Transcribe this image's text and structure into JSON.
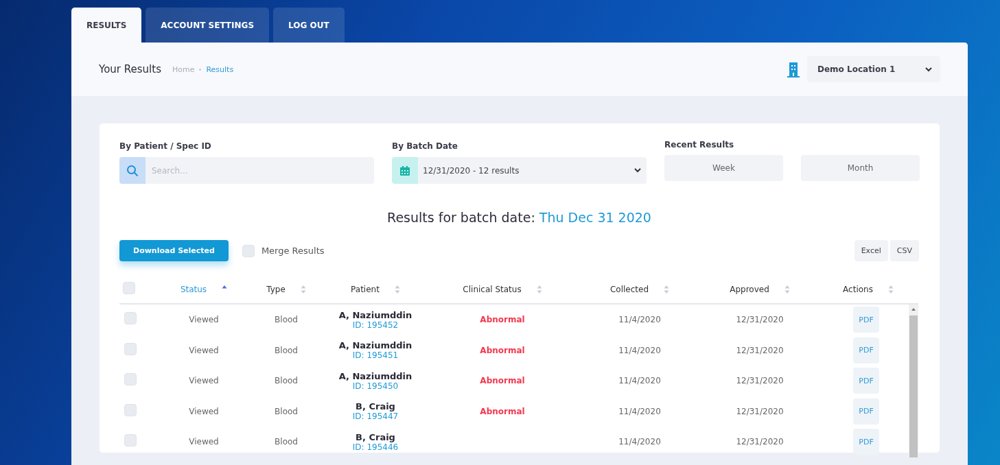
{
  "tabs": [
    {
      "label": "RESULTS",
      "selected": true
    },
    {
      "label": "ACCOUNT SETTINGS",
      "selected": false
    },
    {
      "label": "LOG OUT",
      "selected": false
    }
  ],
  "header": {
    "title": "Your Results",
    "breadcrumb": [
      {
        "label": "Home",
        "current": false
      },
      {
        "label": "Results",
        "current": true
      }
    ],
    "location": "Demo Location 1"
  },
  "filters": {
    "patient_label": "By Patient / Spec ID",
    "search": {
      "placeholder": "Search..."
    },
    "batch_label": "By Batch Date",
    "batch_value": "12/31/2020 - 12 results",
    "recent_label": "Recent Results",
    "recent_buttons": [
      "Week",
      "Month"
    ]
  },
  "results_heading": {
    "prefix": "Results for batch date:",
    "date": "Thu Dec 31 2020"
  },
  "toolbar": {
    "download": "Download Selected",
    "merge": {
      "label": "Merge Results",
      "checked": false
    },
    "exports": [
      "Excel",
      "CSV"
    ]
  },
  "table": {
    "columns": [
      {
        "label": "Status",
        "sorted": true
      },
      {
        "label": "Type",
        "sorted": false
      },
      {
        "label": "Patient",
        "sorted": false
      },
      {
        "label": "Clinical Status",
        "sorted": false
      },
      {
        "label": "Collected",
        "sorted": false
      },
      {
        "label": "Approved",
        "sorted": false
      },
      {
        "label": "Actions",
        "sorted": false
      }
    ],
    "select_all": false,
    "rows": [
      {
        "selected": false,
        "status": "Viewed",
        "type": "Blood",
        "patient": "A, Naziumddin",
        "id": "ID: 195452",
        "clinical": "Abnormal",
        "collected": "11/4/2020",
        "approved": "12/31/2020",
        "action": "PDF"
      },
      {
        "selected": false,
        "status": "Viewed",
        "type": "Blood",
        "patient": "A, Naziumddin",
        "id": "ID: 195451",
        "clinical": "Abnormal",
        "collected": "11/4/2020",
        "approved": "12/31/2020",
        "action": "PDF"
      },
      {
        "selected": false,
        "status": "Viewed",
        "type": "Blood",
        "patient": "A, Naziumddin",
        "id": "ID: 195450",
        "clinical": "Abnormal",
        "collected": "11/4/2020",
        "approved": "12/31/2020",
        "action": "PDF"
      },
      {
        "selected": false,
        "status": "Viewed",
        "type": "Blood",
        "patient": "B, Craig",
        "id": "ID: 195447",
        "clinical": "Abnormal",
        "collected": "11/4/2020",
        "approved": "12/31/2020",
        "action": "PDF"
      },
      {
        "selected": false,
        "status": "Viewed",
        "type": "Blood",
        "patient": "B, Craig",
        "id": "ID: 195446",
        "collected": "11/4/2020",
        "approved": "12/31/2020",
        "action": "PDF"
      }
    ]
  }
}
